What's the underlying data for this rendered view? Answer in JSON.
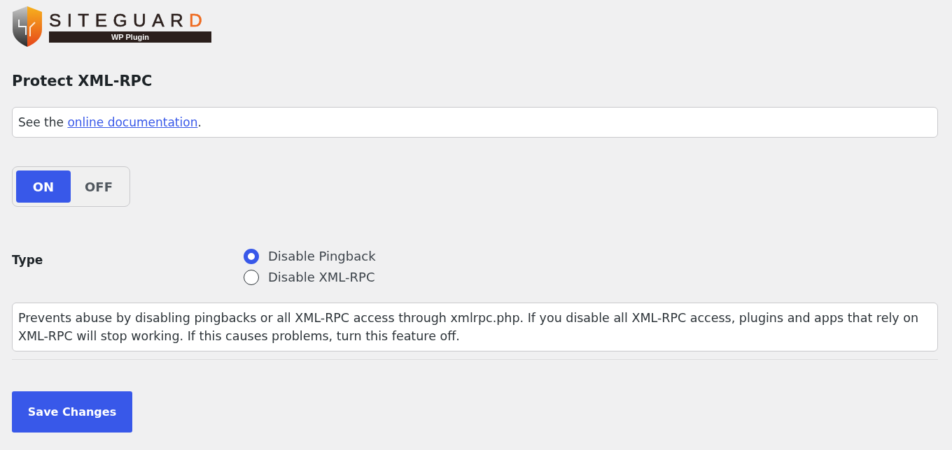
{
  "logo": {
    "wordmark": "SITEGUARD",
    "tagline": "WP Plugin"
  },
  "page": {
    "title": "Protect XML-RPC"
  },
  "doc_notice": {
    "text": "See the ",
    "link": "online documentation",
    "suffix": "."
  },
  "toggle": {
    "options": [
      {
        "label": "ON",
        "selected": true
      },
      {
        "label": "OFF",
        "selected": false
      }
    ]
  },
  "type_field": {
    "label": "Type",
    "options": [
      {
        "label": "Disable Pingback",
        "selected": true
      },
      {
        "label": "Disable XML-RPC",
        "selected": false
      }
    ]
  },
  "description": "Prevents abuse by disabling pingbacks or all XML-RPC access through xmlrpc.php. If you disable all XML-RPC access, plugins and apps that rely on XML-RPC will stop working. If this causes problems, turn this feature off.",
  "save_button": {
    "label": "Save Changes"
  }
}
